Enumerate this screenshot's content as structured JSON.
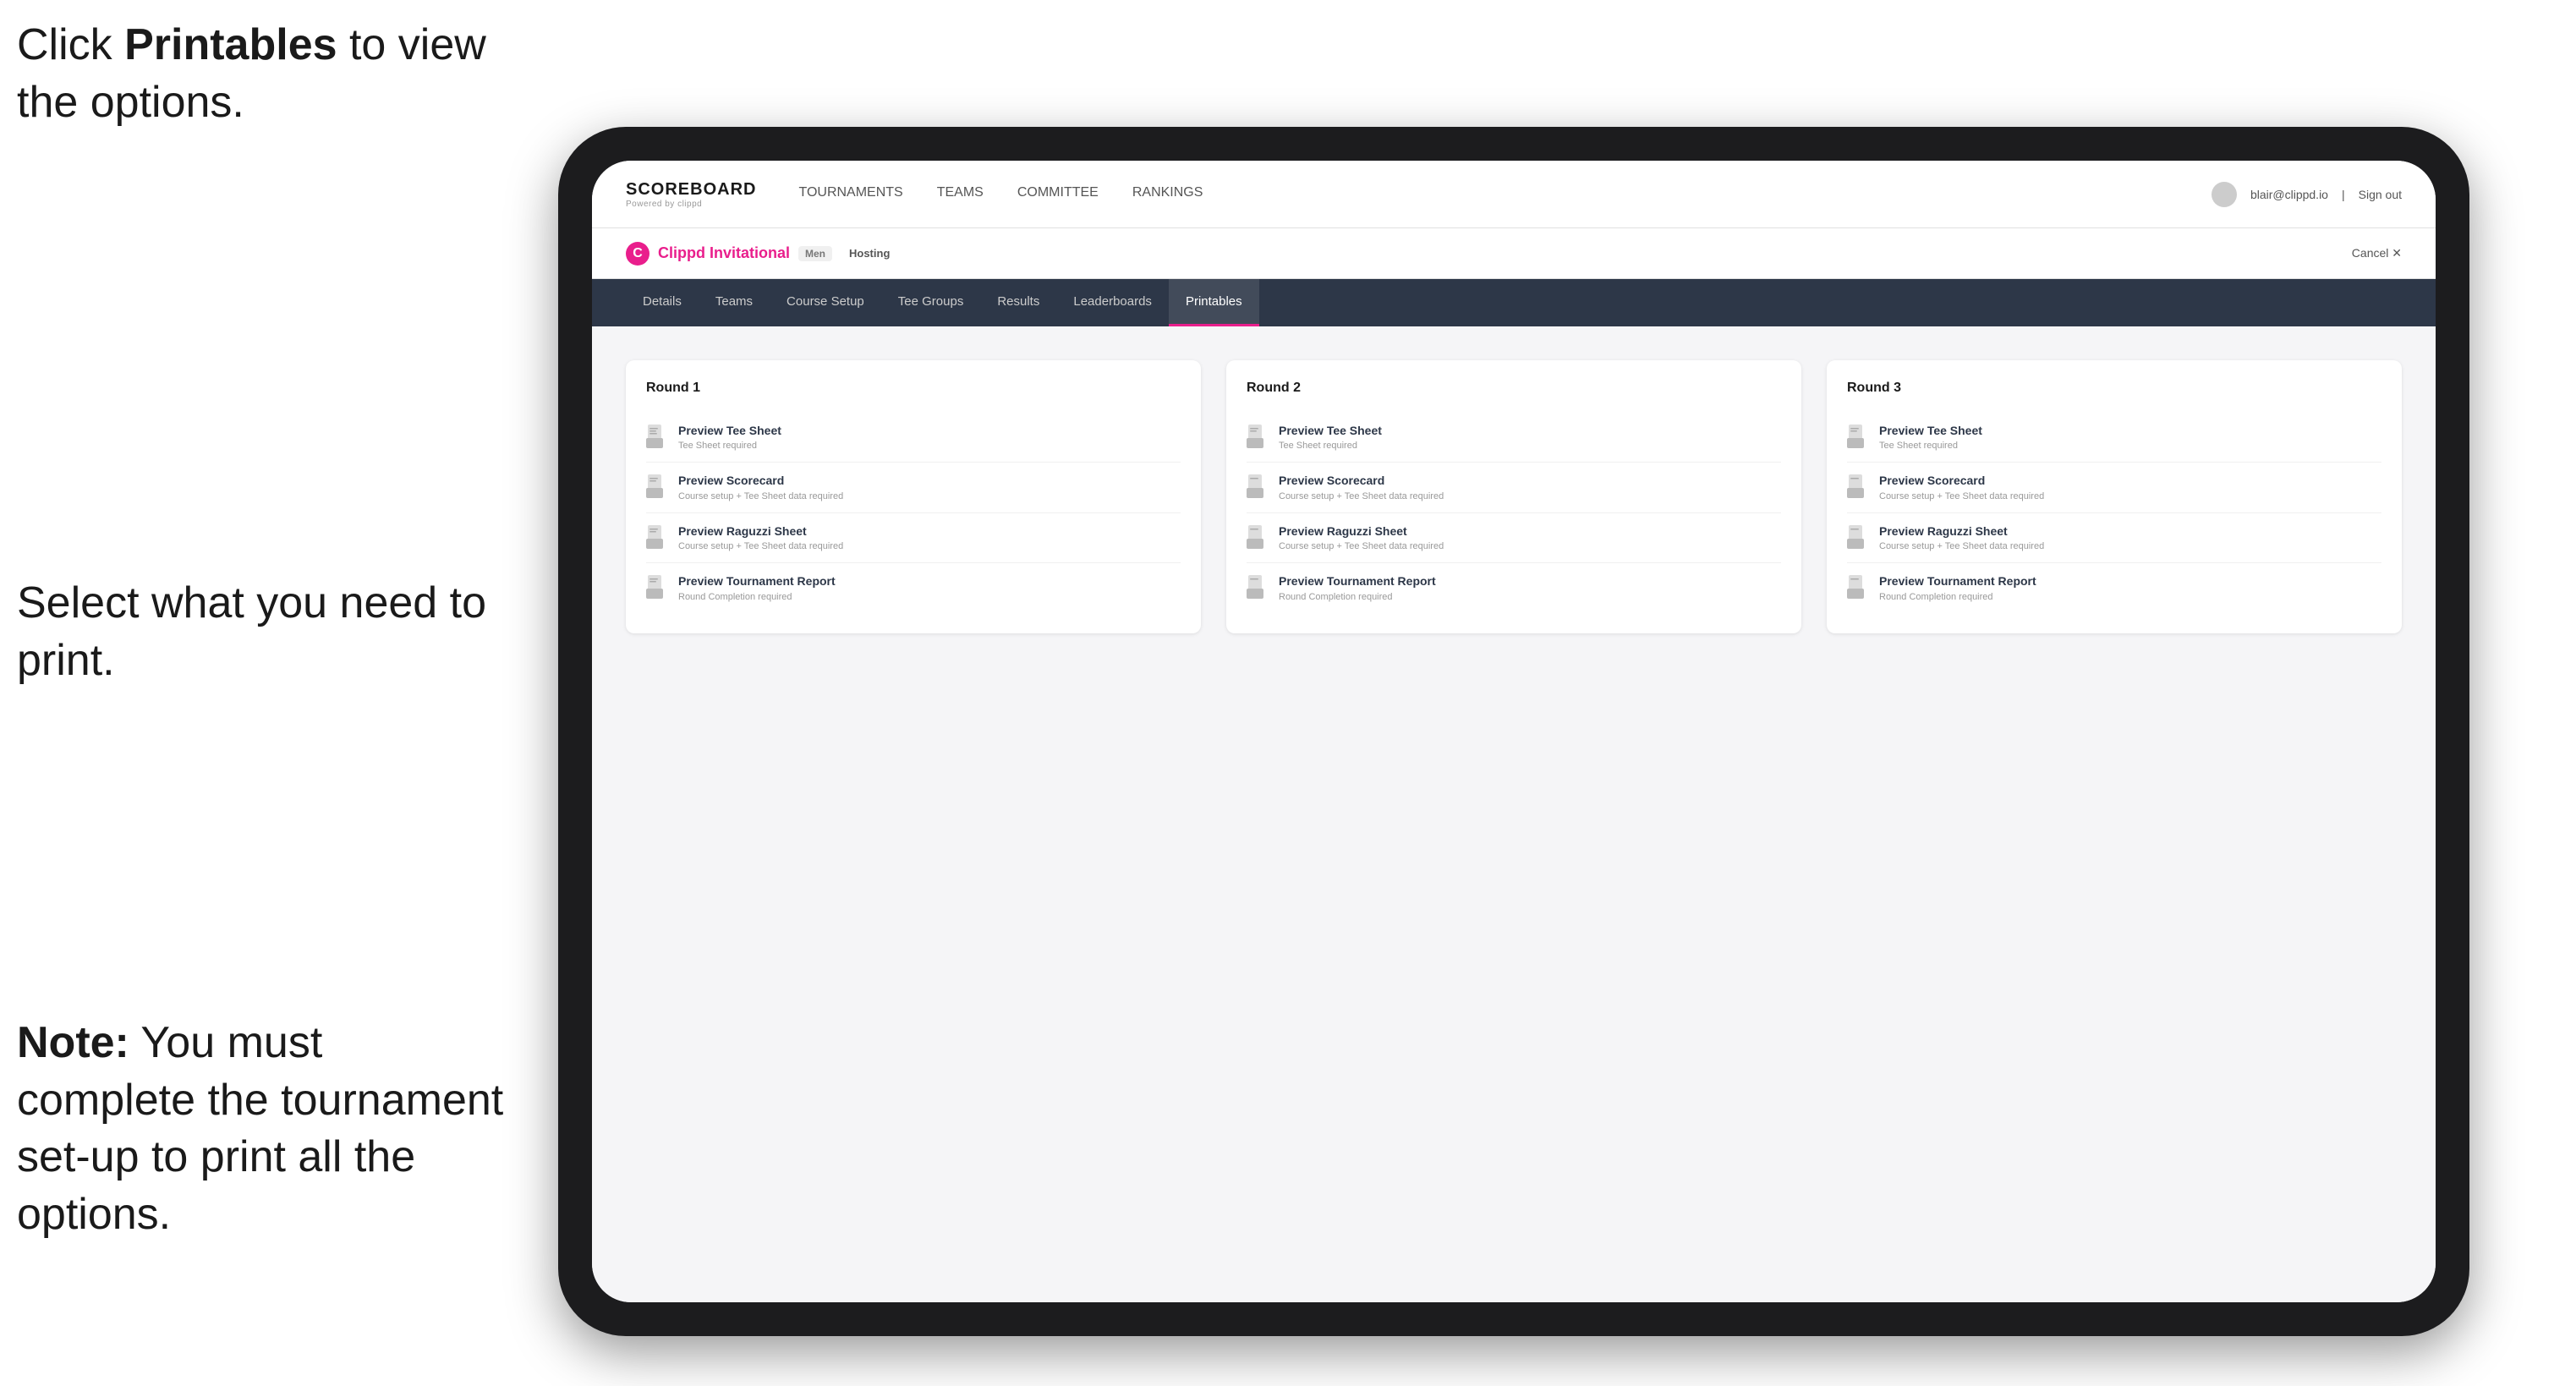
{
  "instructions": {
    "top_line1": "Click ",
    "top_bold": "Printables",
    "top_line2": " to",
    "top_line3": "view the options.",
    "middle": "Select what you\nneed to print.",
    "bottom_bold": "Note:",
    "bottom_text": " You must\ncomplete the\ntournament set-up\nto print all the options."
  },
  "top_nav": {
    "logo": "SCOREBOARD",
    "logo_sub": "Powered by clippd",
    "links": [
      "TOURNAMENTS",
      "TEAMS",
      "COMMITTEE",
      "RANKINGS"
    ],
    "user_email": "blair@clippd.io",
    "sign_out": "Sign out"
  },
  "sub_nav": {
    "logo_letter": "C",
    "tournament_name": "Clippd Invitational",
    "tournament_badge": "Men",
    "tournament_status": "Hosting",
    "cancel": "Cancel ✕"
  },
  "tabs": [
    {
      "label": "Details"
    },
    {
      "label": "Teams"
    },
    {
      "label": "Course Setup"
    },
    {
      "label": "Tee Groups"
    },
    {
      "label": "Results"
    },
    {
      "label": "Leaderboards"
    },
    {
      "label": "Printables",
      "active": true
    }
  ],
  "rounds": [
    {
      "title": "Round 1",
      "items": [
        {
          "title": "Preview Tee Sheet",
          "subtitle": "Tee Sheet required"
        },
        {
          "title": "Preview Scorecard",
          "subtitle": "Course setup + Tee Sheet data required"
        },
        {
          "title": "Preview Raguzzi Sheet",
          "subtitle": "Course setup + Tee Sheet data required"
        },
        {
          "title": "Preview Tournament Report",
          "subtitle": "Round Completion required"
        }
      ]
    },
    {
      "title": "Round 2",
      "items": [
        {
          "title": "Preview Tee Sheet",
          "subtitle": "Tee Sheet required"
        },
        {
          "title": "Preview Scorecard",
          "subtitle": "Course setup + Tee Sheet data required"
        },
        {
          "title": "Preview Raguzzi Sheet",
          "subtitle": "Course setup + Tee Sheet data required"
        },
        {
          "title": "Preview Tournament Report",
          "subtitle": "Round Completion required"
        }
      ]
    },
    {
      "title": "Round 3",
      "items": [
        {
          "title": "Preview Tee Sheet",
          "subtitle": "Tee Sheet required"
        },
        {
          "title": "Preview Scorecard",
          "subtitle": "Course setup + Tee Sheet data required"
        },
        {
          "title": "Preview Raguzzi Sheet",
          "subtitle": "Course setup + Tee Sheet data required"
        },
        {
          "title": "Preview Tournament Report",
          "subtitle": "Round Completion required"
        }
      ]
    }
  ]
}
